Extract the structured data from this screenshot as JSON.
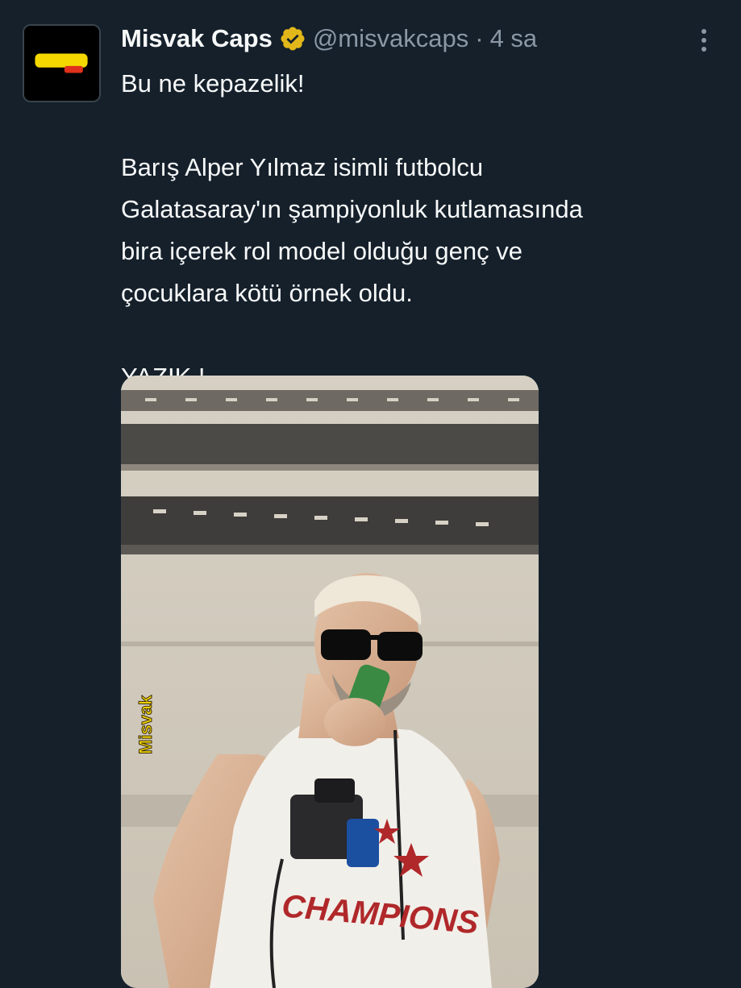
{
  "tweet": {
    "author": {
      "display_name": "Misvak Caps",
      "handle": "@misvakcaps",
      "verified": true,
      "avatar_icon": "misvak-caps-logo"
    },
    "separator": "·",
    "time": "4 sa",
    "more_icon": "more-vertical-icon",
    "text": {
      "line1": "Bu ne kepazelik!",
      "paragraph2": [
        "Barış Alper Yılmaz isimli futbolcu",
        "Galatasaray'ın şampiyonluk kutlamasında",
        "bira içerek rol model olduğu genç ve",
        "çocuklara kötü örnek oldu."
      ],
      "closing": "YAZIK !"
    },
    "media": {
      "type": "video-still",
      "logo_text": "Misvak",
      "shirt_text": "CHAMPIONS"
    }
  },
  "colors": {
    "background": "#15202b",
    "text_primary": "#f7f9f9",
    "text_secondary": "#8b98a5",
    "verified_badge": "#e2b719",
    "logo_yellow": "#f5d800"
  }
}
